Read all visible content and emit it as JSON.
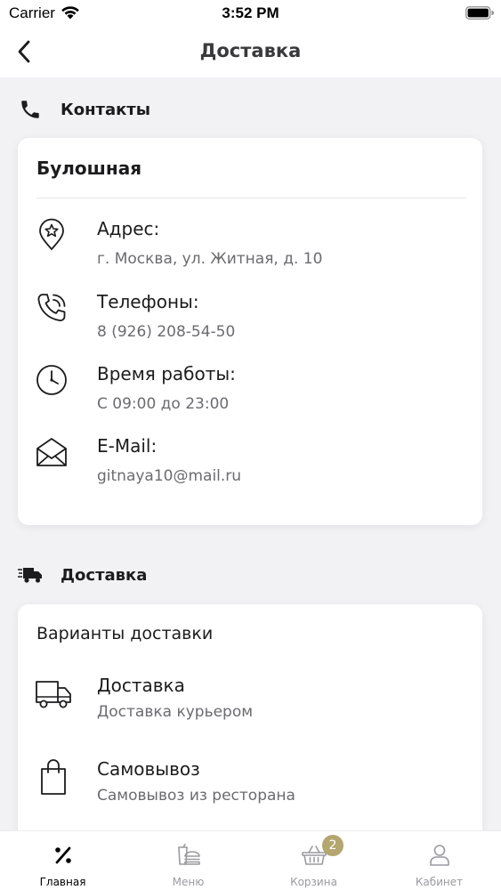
{
  "status_bar": {
    "carrier": "Carrier",
    "time": "3:52 PM"
  },
  "nav": {
    "title": "Доставка",
    "back_icon": "chevron-left-icon"
  },
  "contacts_section": {
    "label": "Контакты",
    "icon": "phone-icon",
    "card": {
      "title": "Булошная",
      "items": [
        {
          "icon": "location-star-icon",
          "title": "Адрес:",
          "value": "г. Москва, ул. Житная, д. 10"
        },
        {
          "icon": "phone-ringing-icon",
          "title": "Телефоны:",
          "value": "8 (926) 208-54-50"
        },
        {
          "icon": "clock-icon",
          "title": "Время работы:",
          "value": "С 09:00 до 23:00"
        },
        {
          "icon": "mail-icon",
          "title": "E-Mail:",
          "value": "gitnaya10@mail.ru"
        }
      ]
    }
  },
  "delivery_section": {
    "label": "Доставка",
    "icon": "fast-truck-icon",
    "card": {
      "title": "Варианты доставки",
      "items": [
        {
          "icon": "truck-icon",
          "title": "Доставка",
          "value": "Доставка курьером"
        },
        {
          "icon": "shopping-bag-icon",
          "title": "Самовывоз",
          "value": "Самовывоз из ресторана"
        }
      ]
    }
  },
  "tab_bar": {
    "tabs": [
      {
        "label": "Главная",
        "icon": "percent-icon",
        "active": true
      },
      {
        "label": "Меню",
        "icon": "food-menu-icon",
        "active": false
      },
      {
        "label": "Корзина",
        "icon": "basket-icon",
        "active": false
      },
      {
        "label": "Кабинет",
        "icon": "user-icon",
        "active": false
      }
    ],
    "cart_count": "2"
  },
  "colors": {
    "background": "#f2f2f4",
    "card": "#ffffff",
    "badge": "#b4a66f",
    "secondary_text": "#6b6b70",
    "tab_inactive": "#9a9aa0"
  }
}
